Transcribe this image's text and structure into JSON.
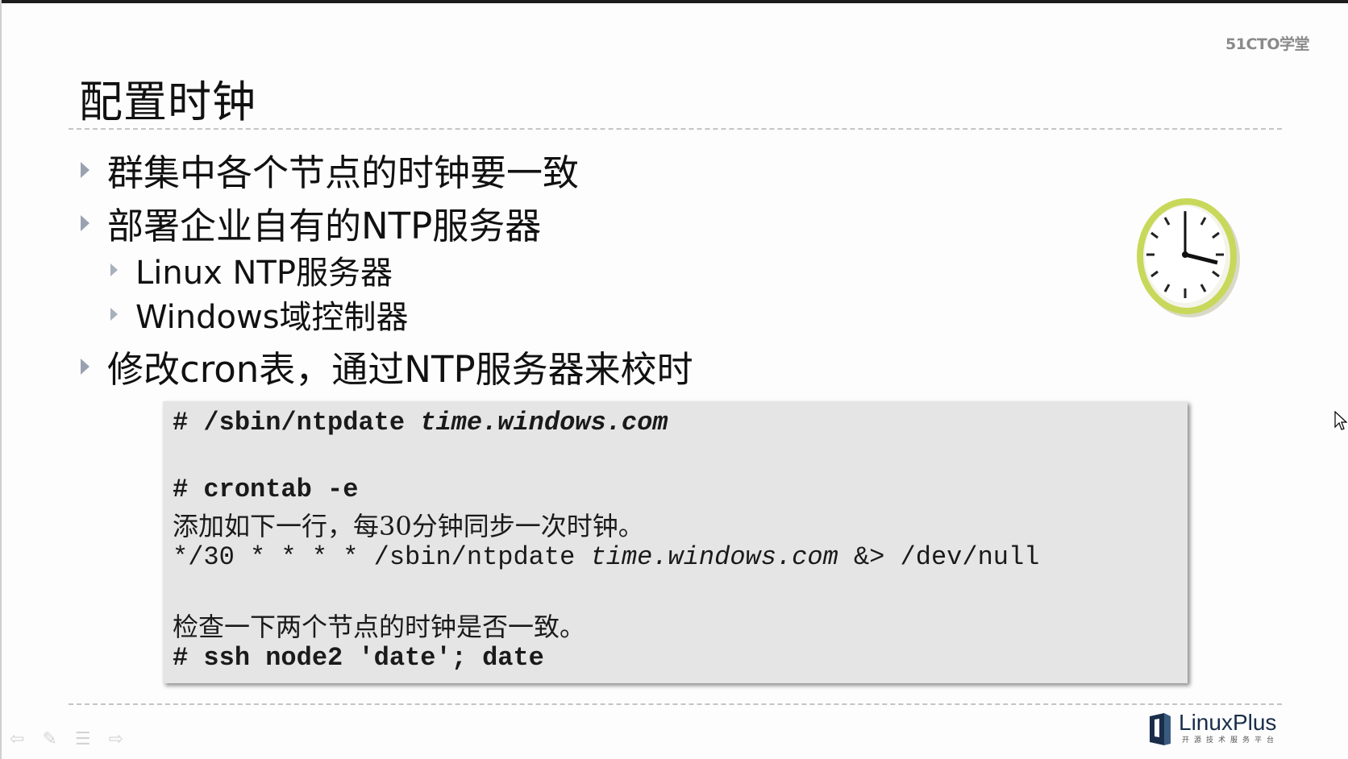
{
  "brand": "51CTO学堂",
  "title": "配置时钟",
  "bullets": {
    "b1": "群集中各个节点的时钟要一致",
    "b2": "部署企业自有的NTP服务器",
    "b2_sub1": "Linux NTP服务器",
    "b2_sub2": "Windows域控制器",
    "b3": "修改cron表，通过NTP服务器来校时"
  },
  "code": {
    "line1_prompt": "# /sbin/ntpdate ",
    "line1_host": "time.windows.com",
    "line2": "# crontab -e",
    "line3": "添加如下一行，每30分钟同步一次时钟。",
    "line4_prefix": "*/30 * * * * /sbin/ntpdate ",
    "line4_host": "time.windows.com",
    "line4_suffix": " &> /dev/null",
    "line5": "检查一下两个节点的时钟是否一致。",
    "line6": "# ssh node2 'date'; date"
  },
  "logo": {
    "name": "LinuxPlus",
    "tagline": "开源技术服务平台"
  },
  "icons": {
    "clock": "clock-icon",
    "cursor": "mouse-cursor-icon",
    "nav_prev": "arrow-left-icon",
    "nav_pen": "pen-icon",
    "nav_menu": "menu-icon",
    "nav_next": "arrow-right-icon"
  },
  "colors": {
    "accent_bullet": "#9aa2b0",
    "code_bg": "#e5e5e5",
    "clock_rim": "#c8d85a"
  }
}
